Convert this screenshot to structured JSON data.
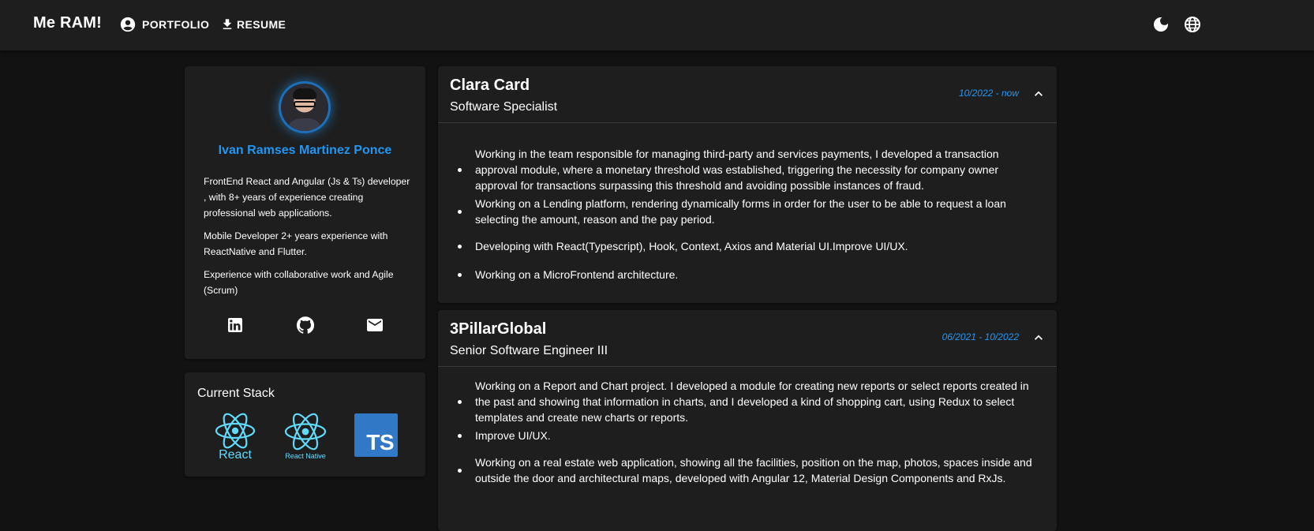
{
  "header": {
    "brand": "Me RAM!",
    "nav": [
      {
        "label": "PORTFOLIO",
        "icon": "account-circle-icon"
      },
      {
        "label": "RESUME",
        "icon": "download-icon"
      }
    ],
    "actions": [
      {
        "icon": "moon-icon"
      },
      {
        "icon": "globe-icon"
      }
    ]
  },
  "profile": {
    "name": "Ivan Ramses Martinez Ponce",
    "bio": [
      "FrontEnd React and Angular (Js & Ts) developer , with 8+ years of experience creating professional web applications.",
      "Mobile Developer 2+ years experience with ReactNative and Flutter.",
      "Experience with collaborative work and Agile (Scrum)"
    ],
    "socials": [
      "linkedin-icon",
      "github-icon",
      "mail-icon"
    ]
  },
  "stack": {
    "title": "Current Stack",
    "items": [
      {
        "label": "React"
      },
      {
        "label": "React Native"
      },
      {
        "label": "TS"
      }
    ]
  },
  "experience": [
    {
      "company": "Clara Card",
      "role": "Software Specialist",
      "period": "10/2022 - now",
      "bullets": [
        "Working in the team responsible for managing third-party and services payments, I developed a transaction approval module, where a monetary threshold was established, triggering the necessity for company owner approval for transactions surpassing this threshold and avoiding possible instances of fraud.",
        "Working on a Lending platform, rendering dynamically forms in order for the user to be able to request a loan selecting the amount, reason and the pay period.",
        "Developing with React(Typescript), Hook, Context, Axios and Material UI.Improve UI/UX.",
        "Working on a MicroFrontend architecture."
      ]
    },
    {
      "company": "3PillarGlobal",
      "role": "Senior Software Engineer III",
      "period": "06/2021 - 10/2022",
      "bullets": [
        "Working on a Report and Chart project. I developed a module for creating new reports or select reports created in the past and showing that information in charts, and I developed a kind of shopping cart, using Redux to select templates and create new charts or reports.",
        "Improve UI/UX.",
        "Working on a real estate web application, showing all the facilities, position on the map, photos, spaces inside and outside the door and architectural maps, developed with Angular 12, Material Design Components and RxJs."
      ]
    }
  ],
  "colors": {
    "accent": "#2196f3",
    "background": "#121212",
    "surface": "#1e1e1e",
    "text": "#ffffff",
    "react": "#61dafb",
    "typescript": "#3178c6"
  }
}
